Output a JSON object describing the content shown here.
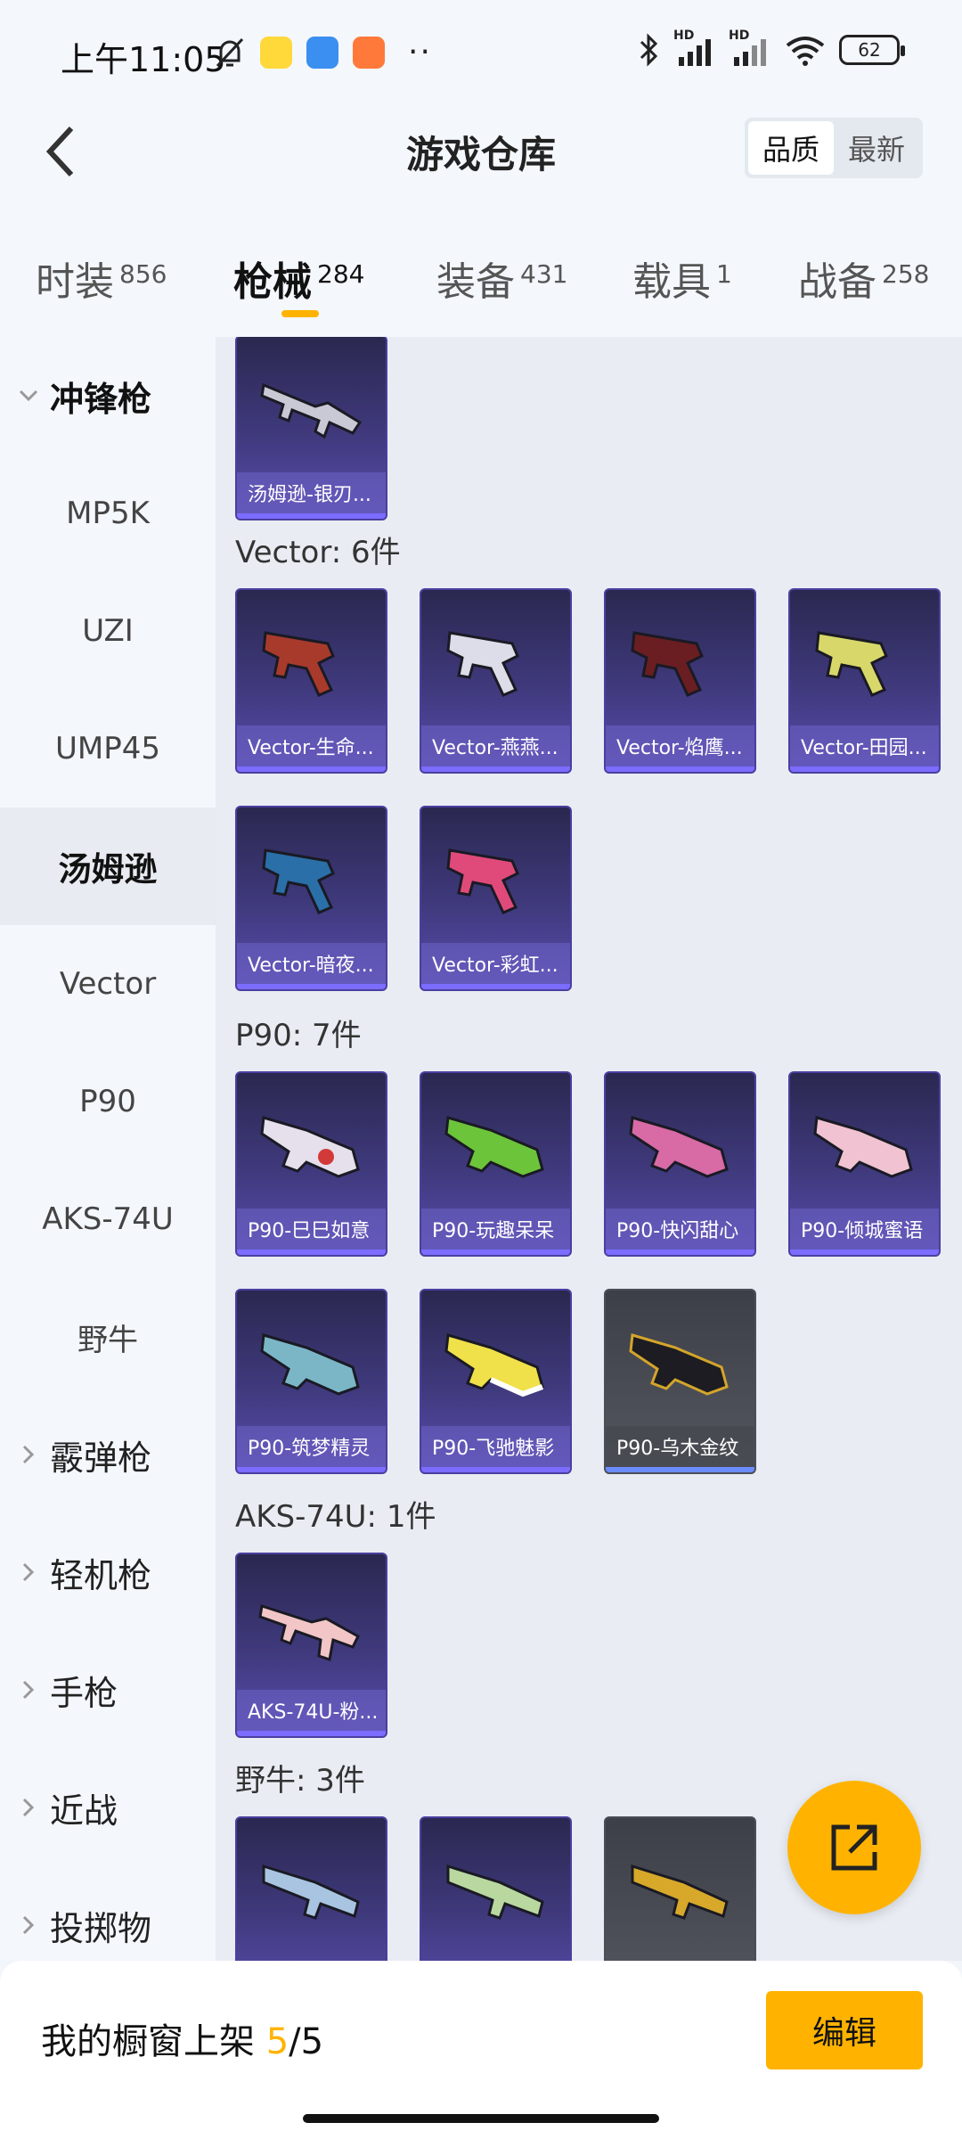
{
  "status_bar": {
    "time": "上午11:05",
    "battery": "62",
    "hd1": "HD",
    "hd2": "HD"
  },
  "header": {
    "title": "游戏仓库",
    "sort_options": [
      "品质",
      "最新"
    ],
    "sort_selected": "品质"
  },
  "tabs": [
    {
      "label": "时装",
      "count": "856"
    },
    {
      "label": "枪械",
      "count": "284"
    },
    {
      "label": "装备",
      "count": "431"
    },
    {
      "label": "载具",
      "count": "1"
    },
    {
      "label": "战备",
      "count": "258"
    }
  ],
  "sidebar": {
    "items": [
      {
        "label": "冲锋枪",
        "type": "group",
        "expanded": true
      },
      {
        "label": "MP5K"
      },
      {
        "label": "UZI"
      },
      {
        "label": "UMP45"
      },
      {
        "label": "汤姆逊",
        "active": true
      },
      {
        "label": "Vector"
      },
      {
        "label": "P90"
      },
      {
        "label": "AKS-74U"
      },
      {
        "label": "野牛"
      },
      {
        "label": "霰弹枪",
        "type": "group"
      },
      {
        "label": "轻机枪",
        "type": "group"
      },
      {
        "label": "手枪",
        "type": "group"
      },
      {
        "label": "近战",
        "type": "group"
      },
      {
        "label": "投掷物",
        "type": "group"
      }
    ]
  },
  "sections": {
    "thompson": {
      "items": [
        {
          "label": "汤姆逊-银刃..."
        }
      ]
    },
    "vector": {
      "title": "Vector: 6件",
      "items": [
        {
          "label": "Vector-生命..."
        },
        {
          "label": "Vector-燕燕..."
        },
        {
          "label": "Vector-焰鹰..."
        },
        {
          "label": "Vector-田园..."
        },
        {
          "label": "Vector-暗夜..."
        },
        {
          "label": "Vector-彩虹..."
        }
      ]
    },
    "p90": {
      "title": "P90: 7件",
      "items": [
        {
          "label": "P90-巳巳如意"
        },
        {
          "label": "P90-玩趣呆呆"
        },
        {
          "label": "P90-快闪甜心"
        },
        {
          "label": "P90-倾城蜜语"
        },
        {
          "label": "P90-筑梦精灵"
        },
        {
          "label": "P90-飞驰魅影"
        },
        {
          "label": "P90-乌木金纹"
        }
      ]
    },
    "aks": {
      "title": "AKS-74U: 1件",
      "items": [
        {
          "label": "AKS-74U-粉..."
        }
      ]
    },
    "bizon": {
      "title": "野牛: 3件"
    }
  },
  "bottom_bar": {
    "showcase_label": "我的橱窗上架",
    "showcase_current": "5",
    "showcase_total": "/5",
    "edit_label": "编辑"
  },
  "colors": {
    "accent": "#ffb300",
    "card_purple": "#403a7e",
    "card_gray": "#55575f"
  },
  "icons": {
    "back": "back-arrow-icon",
    "share": "share-out-icon",
    "expand": "chevron-down-icon",
    "collapse": "chevron-right-icon"
  }
}
